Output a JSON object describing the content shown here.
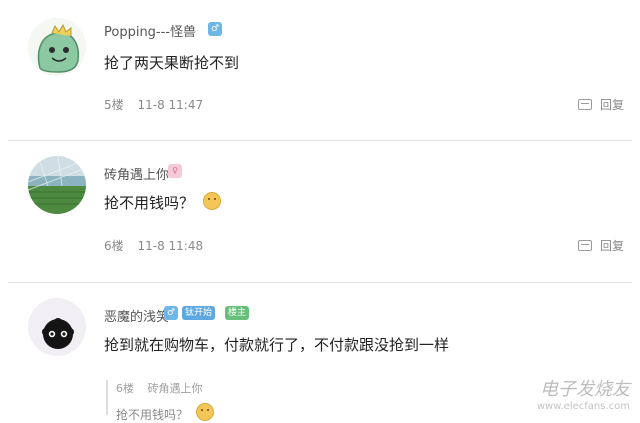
{
  "comments": [
    {
      "username": "Popping---怪兽",
      "badges": [
        "♂"
      ],
      "text": "抢了两天果断抢不到",
      "floor": "5楼",
      "time": "11-8 11:47",
      "reply_label": "回复"
    },
    {
      "username": "砖角遇上你",
      "badges": [
        "♀"
      ],
      "text": "抢不用钱吗？",
      "floor": "6楼",
      "time": "11-8 11:48",
      "reply_label": "回复"
    },
    {
      "username": "恶魔的浅笑",
      "badges": [
        "♂",
        "钛开始",
        "楼主"
      ],
      "text": "抢到就在购物车，付款就行了，不付款跟没抢到一样",
      "quote": {
        "floor": "6楼",
        "username": "砖角遇上你",
        "text": "抢不用钱吗？"
      }
    }
  ],
  "watermark": {
    "line1": "电子发烧友",
    "line2": "www.elecfans.com"
  },
  "colors": {
    "divider": "#e2e2e2",
    "meta_text": "#8a8a8a",
    "badge_blue": "#5da8e0",
    "badge_green": "#66c07a"
  }
}
